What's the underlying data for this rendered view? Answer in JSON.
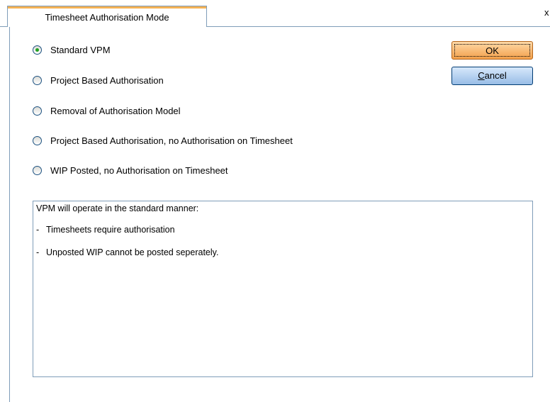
{
  "tab": {
    "title": "Timesheet Authorisation Mode"
  },
  "window": {
    "close_glyph": "x"
  },
  "options": [
    {
      "label": "Standard VPM",
      "checked": true
    },
    {
      "label": "Project Based Authorisation",
      "checked": false
    },
    {
      "label": "Removal of Authorisation Model",
      "checked": false
    },
    {
      "label": "Project Based Authorisation, no Authorisation on Timesheet",
      "checked": false
    },
    {
      "label": "WIP Posted, no Authorisation on Timesheet",
      "checked": false
    }
  ],
  "buttons": {
    "ok_label": "OK",
    "cancel_first": "C",
    "cancel_rest": "ancel"
  },
  "description": {
    "title": "VPM will operate in the standard manner:",
    "items": [
      {
        "dash": "-",
        "text": "Timesheets require authorisation"
      },
      {
        "dash": "-",
        "text": "Unposted WIP cannot be posted seperately."
      }
    ]
  },
  "colors": {
    "tab_accent": "#f4b255",
    "border": "#7f9db9",
    "ok_button": "#f3a04a",
    "cancel_button": "#98bde6",
    "radio_dot": "#21a121"
  }
}
